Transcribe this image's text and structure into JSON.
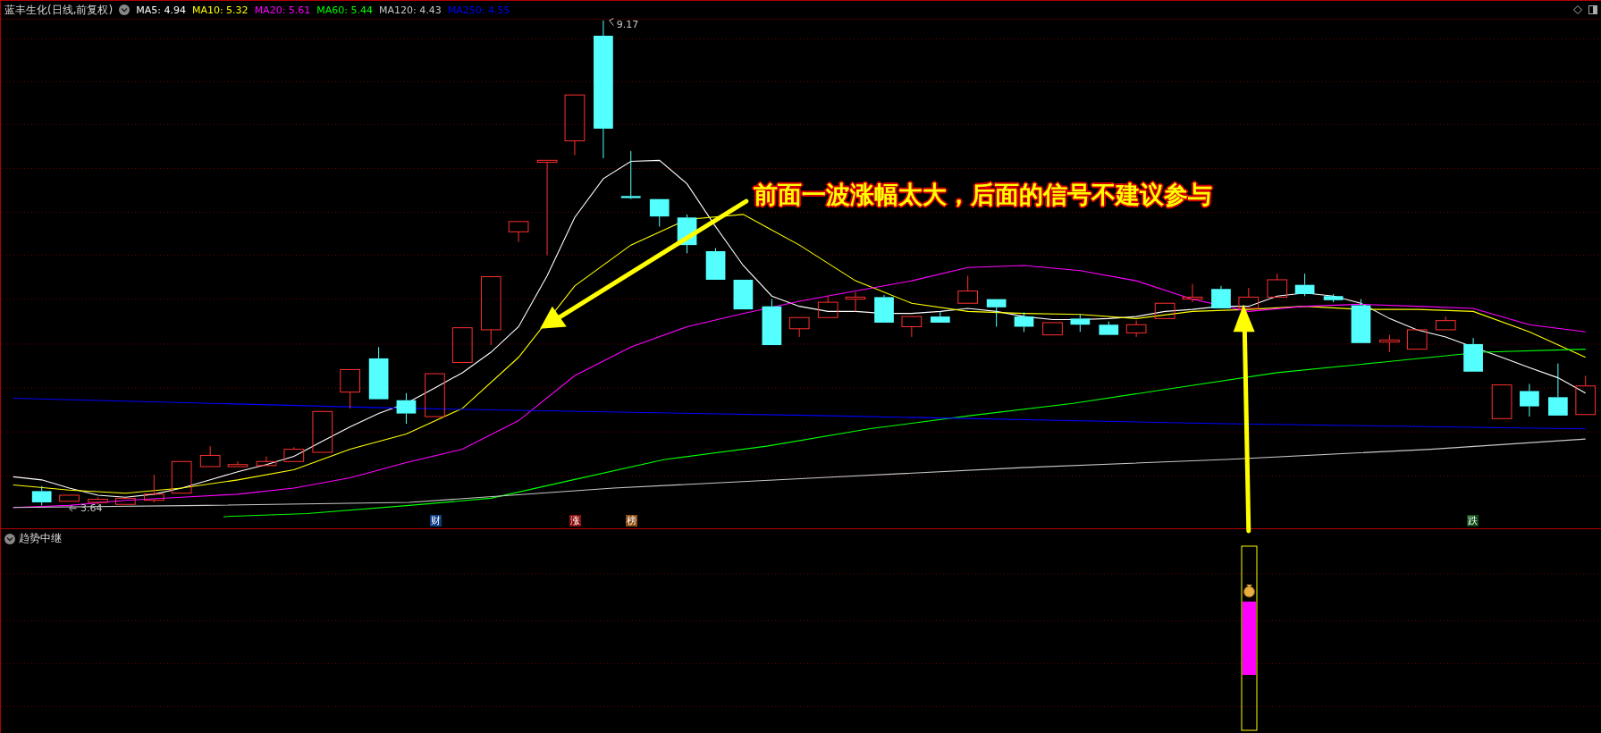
{
  "header": {
    "title": "蓝丰生化(日线,前复权)",
    "averages": [
      {
        "text": "MA5: 4.94",
        "color": "#ffffff"
      },
      {
        "text": "MA10: 5.32",
        "color": "#ffff00"
      },
      {
        "text": "MA20: 5.61",
        "color": "#ff00ff"
      },
      {
        "text": "MA60: 5.44",
        "color": "#00ff00"
      },
      {
        "text": "MA120: 4.43",
        "color": "#c8c8c8"
      },
      {
        "text": "MA250: 4.55",
        "color": "#0000ff"
      }
    ]
  },
  "chart": {
    "high_label": "9.17",
    "low_label": "3.64",
    "annotation": "前面一波涨幅太大，后面的信号不建议参与",
    "markers": [
      {
        "text": "财",
        "color": "#0c3c80"
      },
      {
        "text": "涨",
        "color": "#8c0a0a"
      },
      {
        "text": "榜",
        "color": "#8c4a10"
      },
      {
        "text": "跌",
        "color": "#0a4a14"
      }
    ]
  },
  "indicator": {
    "title": "趋势中继"
  }
}
